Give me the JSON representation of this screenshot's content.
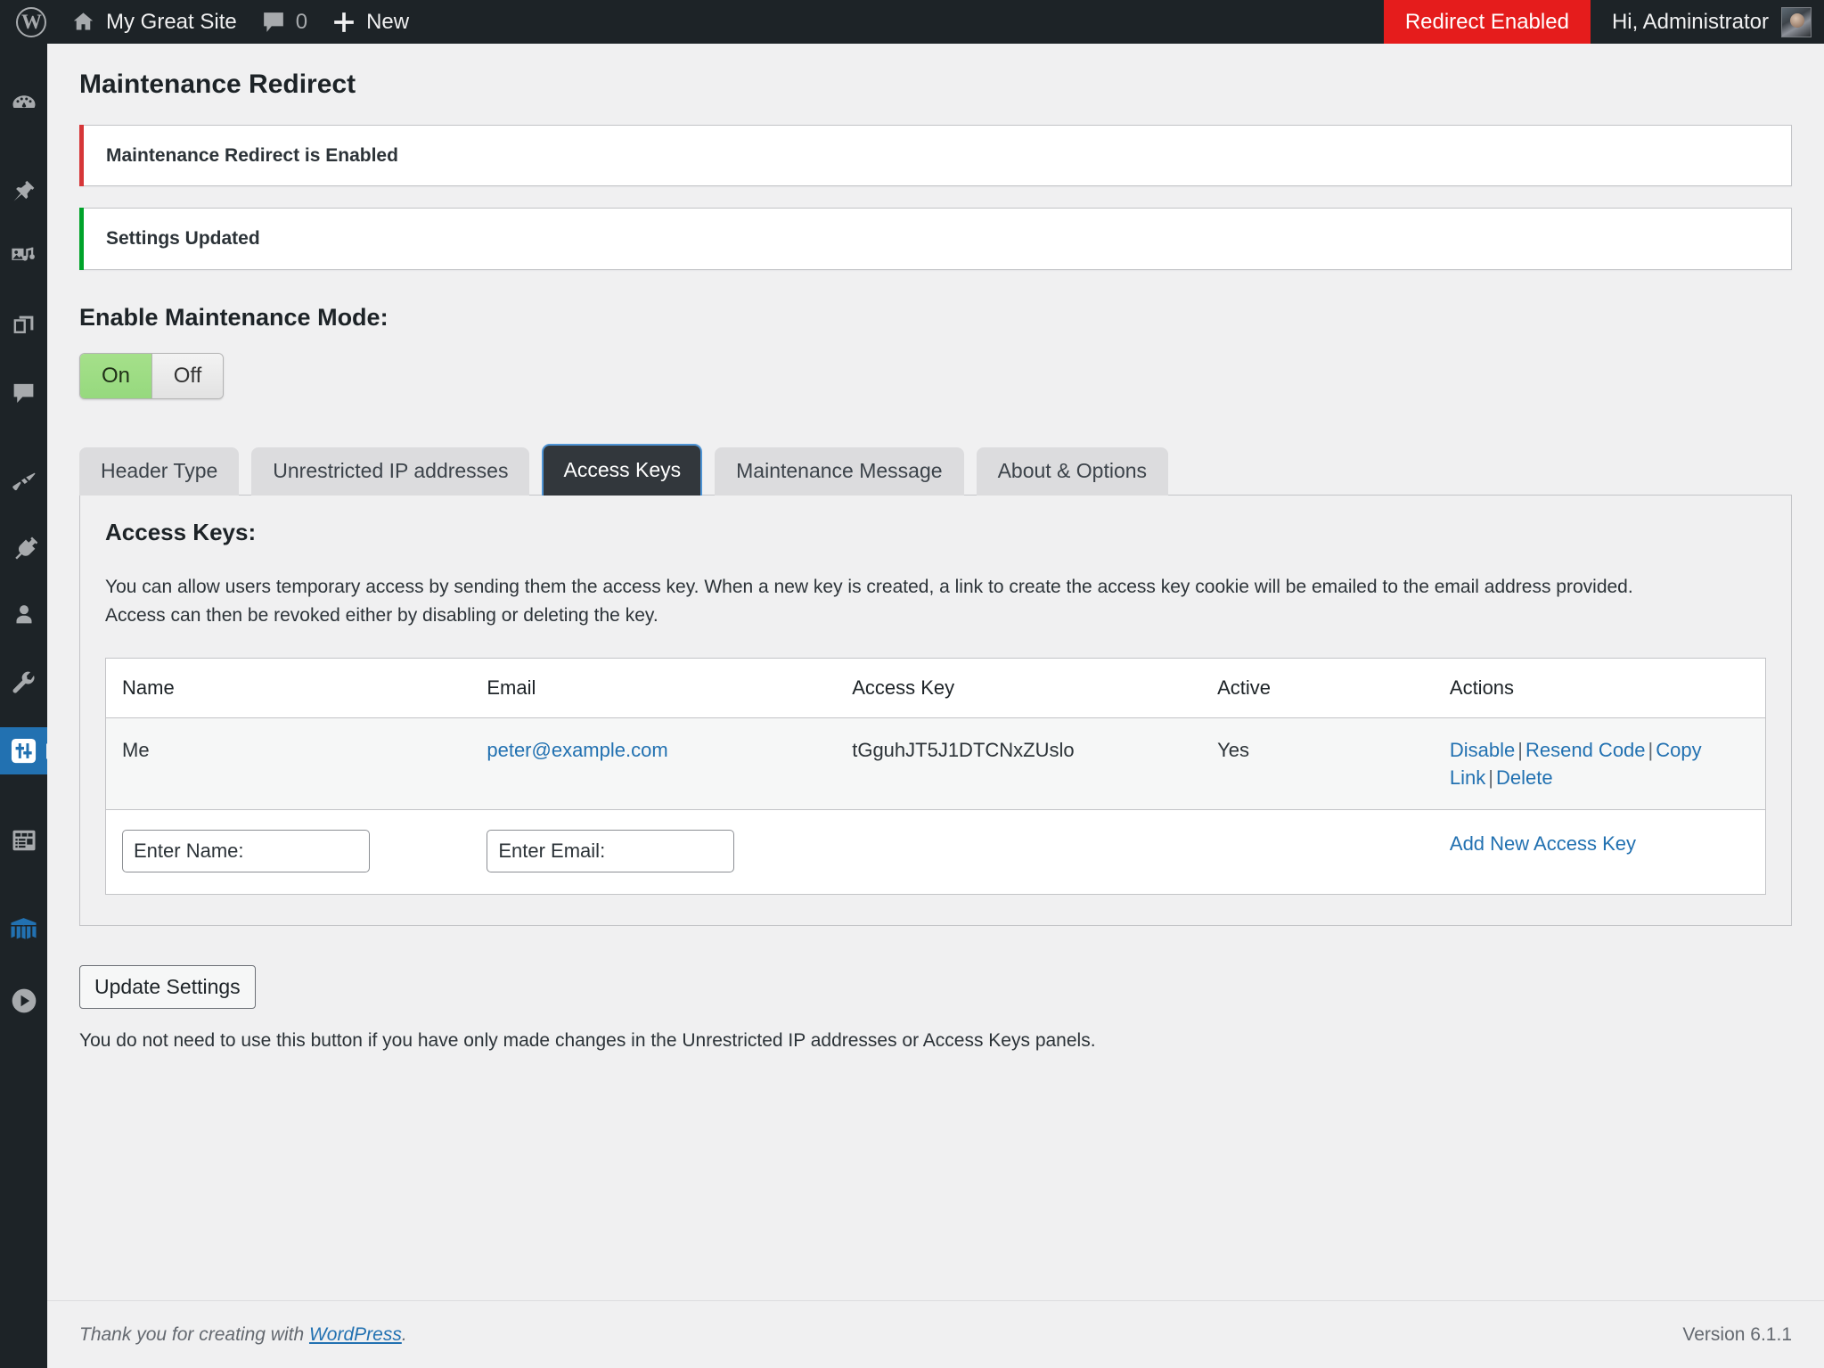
{
  "adminbar": {
    "site_name": "My Great Site",
    "comment_count": "0",
    "new_label": "New",
    "redirect_status": "Redirect Enabled",
    "howdy": "Hi, Administrator",
    "icons": {
      "logo": "wordpress-logo-icon",
      "home": "home-icon",
      "comments": "comment-bubble-icon",
      "new": "plus-icon",
      "avatar": "user-avatar"
    },
    "colors": {
      "bar_bg": "#1d2327",
      "redirect_bg": "#e51c1c"
    }
  },
  "sidebar": {
    "items": [
      {
        "name": "dashboard",
        "icon": "dashboard-gauge-icon",
        "current": false
      },
      {
        "name": "posts",
        "icon": "pushpin-icon",
        "current": false
      },
      {
        "name": "media",
        "icon": "media-photo-music-icon",
        "current": false
      },
      {
        "name": "pages",
        "icon": "pages-stack-icon",
        "current": false
      },
      {
        "name": "comments",
        "icon": "comment-bubble-icon",
        "current": false
      },
      {
        "name": "appearance",
        "icon": "paintbrush-icon",
        "current": false
      },
      {
        "name": "plugins",
        "icon": "plug-icon",
        "current": false
      },
      {
        "name": "users",
        "icon": "user-icon",
        "current": false
      },
      {
        "name": "tools",
        "icon": "wrench-icon",
        "current": false
      },
      {
        "name": "settings-maintenance-redirect",
        "icon": "sliders-icon",
        "current": true
      },
      {
        "name": "forms",
        "icon": "form-layout-icon",
        "current": false
      },
      {
        "name": "security",
        "icon": "shield-fortress-icon",
        "current": false
      },
      {
        "name": "collapse-menu",
        "icon": "play-circle-icon",
        "current": false
      }
    ],
    "colors": {
      "bg": "#1d2327",
      "current_bg": "#2271b1"
    }
  },
  "page": {
    "title": "Maintenance Redirect",
    "notices": [
      {
        "text": "Maintenance Redirect is Enabled",
        "type": "error",
        "color": "#d63638"
      },
      {
        "text": "Settings Updated",
        "type": "success",
        "color": "#00a32a"
      }
    ],
    "maintenance_mode": {
      "heading": "Enable Maintenance Mode:",
      "on_label": "On",
      "off_label": "Off",
      "selected": "On"
    },
    "tabs": [
      {
        "label": "Header Type",
        "active": false
      },
      {
        "label": "Unrestricted IP addresses",
        "active": false
      },
      {
        "label": "Access Keys",
        "active": true
      },
      {
        "label": "Maintenance Message",
        "active": false
      },
      {
        "label": "About & Options",
        "active": false
      }
    ],
    "panel": {
      "title": "Access Keys:",
      "description": "You can allow users temporary access by sending them the access key. When a new key is created, a link to create the access key cookie will be emailed to the email address provided. Access can then be revoked either by disabling or deleting the key.",
      "table": {
        "headers": [
          "Name",
          "Email",
          "Access Key",
          "Active",
          "Actions"
        ],
        "rows": [
          {
            "name": "Me",
            "email": "peter@example.com",
            "access_key": "tGguhJT5J1DTCNxZUslo",
            "active": "Yes",
            "actions": [
              "Disable",
              "Resend Code",
              "Copy Link",
              "Delete"
            ]
          }
        ],
        "add_row": {
          "name_placeholder": "Enter Name:",
          "name_value": "",
          "email_placeholder": "Enter Email:",
          "email_value": "",
          "add_link": "Add New Access Key"
        }
      }
    },
    "submit": {
      "button_label": "Update Settings",
      "note": "You do not need to use this button if you have only made changes in the Unrestricted IP addresses or Access Keys panels."
    }
  },
  "footer": {
    "thanks_prefix": "Thank you for creating with ",
    "wordpress_link": "WordPress",
    "thanks_suffix": ".",
    "version": "Version 6.1.1"
  }
}
